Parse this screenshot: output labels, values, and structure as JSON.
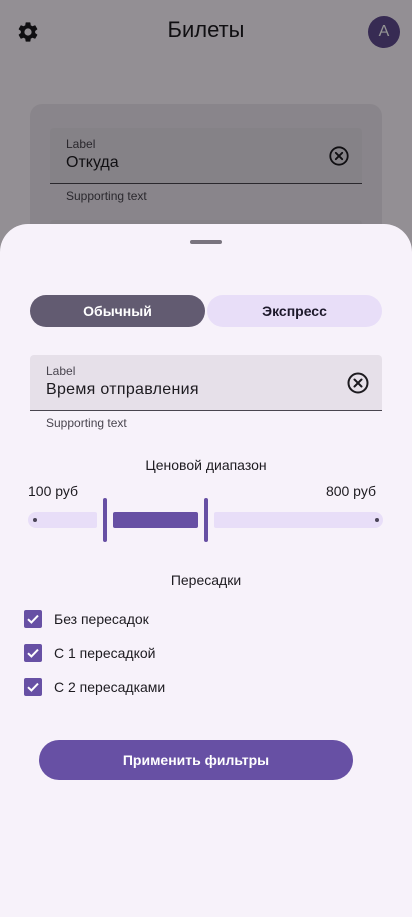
{
  "app": {
    "title": "Билеты",
    "avatar_letter": "A"
  },
  "background_form": {
    "field_label": "Label",
    "field_value": "Откуда",
    "supporting_text": "Supporting text"
  },
  "sheet": {
    "segments": [
      {
        "label": "Обычный",
        "selected": true
      },
      {
        "label": "Экспресс",
        "selected": false
      }
    ],
    "field": {
      "label": "Label",
      "value": "Время отправления",
      "supporting_text": "Supporting text"
    },
    "price_range": {
      "title": "Ценовой диапазон",
      "min_label": "100 руб",
      "max_label": "800 руб"
    },
    "transfers": {
      "title": "Пересадки",
      "options": [
        {
          "label": "Без пересадок",
          "checked": true
        },
        {
          "label": "С 1 пересадкой",
          "checked": true
        },
        {
          "label": "С 2 пересадками",
          "checked": true
        }
      ]
    },
    "apply_button": "Применить фильтры"
  },
  "colors": {
    "primary": "#6750a4",
    "secondary_container": "#e8def8",
    "selected_segment": "#625b71",
    "surface": "#f7f2fa"
  },
  "icons": [
    "gear-icon",
    "clear-icon",
    "check-icon"
  ]
}
